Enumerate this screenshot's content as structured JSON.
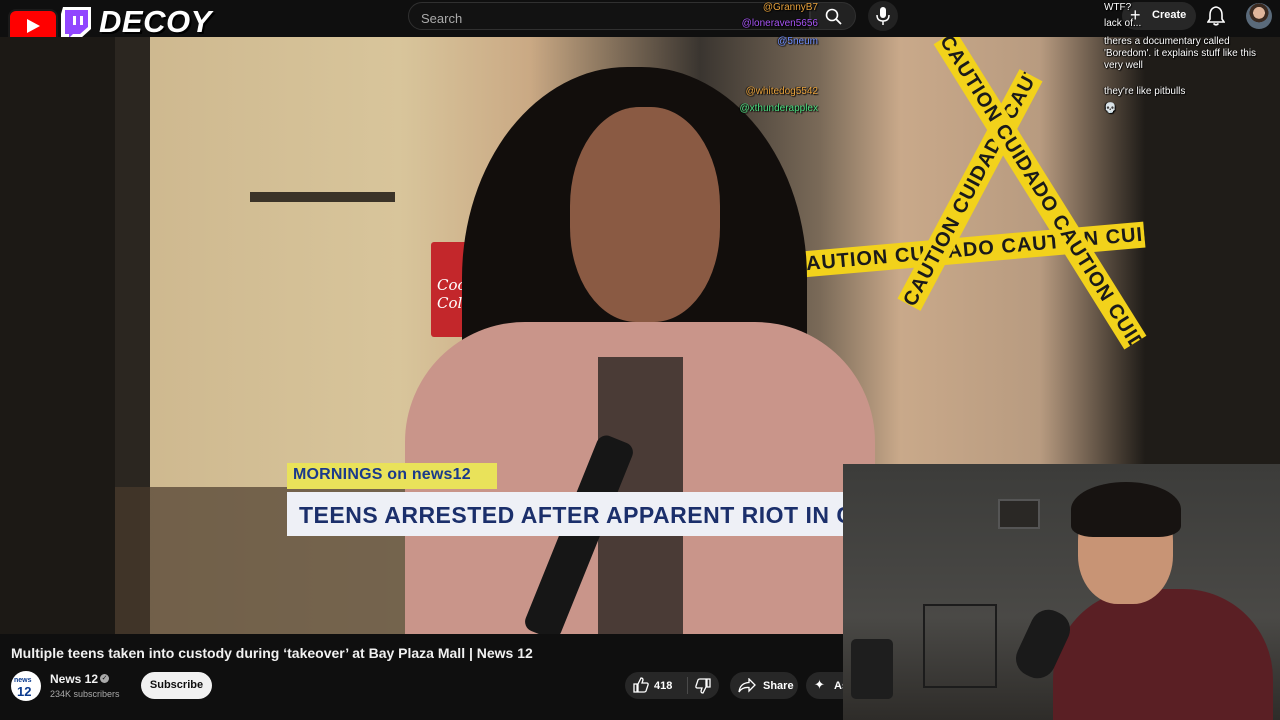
{
  "overlay": {
    "channel_word": "DECOY"
  },
  "search": {
    "placeholder": "Search",
    "value": ""
  },
  "header": {
    "create_label": "Create"
  },
  "chat": [
    {
      "user": "@GrannyB7",
      "user_color": "#e8a23c",
      "message": "WTF?"
    },
    {
      "user": "@loneraven5656",
      "user_color": "#a855f7",
      "message": "lack of..."
    },
    {
      "user": "@5neum",
      "user_color": "#6b8cff",
      "message": "theres a documentary called 'Boredom'. it explains stuff like this very well"
    },
    {
      "user": "@whitedog5542",
      "user_color": "#e8a23c",
      "message": "they're like pitbulls"
    },
    {
      "user": "@xthunderapplex",
      "user_color": "#4ade80",
      "message": "💀"
    }
  ],
  "video_frame": {
    "brand_tag": "MORNINGS on news12",
    "headline": "TEENS ARRESTED AFTER APPARENT RIOT IN C",
    "tape_text": "CAUTION CUIDADO CAUTION CUIDADO CAUTION",
    "sign_text": "Coca-Cola"
  },
  "video": {
    "title": "Multiple teens taken into custody during ‘takeover’ at Bay Plaza Mall | News 12"
  },
  "channel": {
    "avatar_top": "news",
    "avatar_bottom": "12",
    "name": "News 12",
    "verified": "✓",
    "subscribers": "234K subscribers",
    "subscribe_label": "Subscribe"
  },
  "actions": {
    "like_count": "418",
    "share_label": "Share",
    "ask_label": "Ask"
  },
  "colors": {
    "brand_red": "#ff0000",
    "twitch_purple": "#9146ff",
    "caution_yellow": "#f2d21b",
    "news_navy": "#1b2f6b"
  }
}
